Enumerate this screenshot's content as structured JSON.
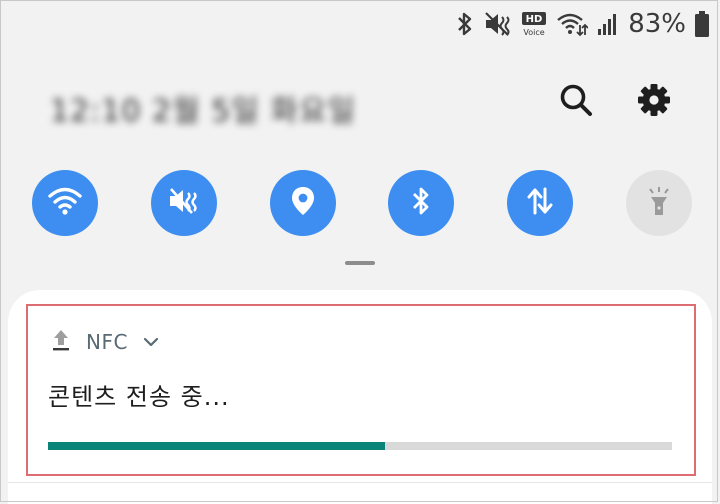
{
  "status_bar": {
    "icons": [
      "bluetooth-icon",
      "vibrate-icon",
      "hd-voice-icon",
      "wifi-calling-icon",
      "signal-icon",
      "battery-icon"
    ],
    "hd_label": "HD",
    "voice_label": "Voice",
    "battery_percent": "83%"
  },
  "header": {
    "datetime": "12:10 2월 5일 화요일",
    "search_icon": "search-icon",
    "settings_icon": "gear-icon"
  },
  "quick_settings": [
    {
      "name": "wifi",
      "icon": "wifi-icon",
      "active": true
    },
    {
      "name": "sound",
      "icon": "vibrate-icon",
      "active": true
    },
    {
      "name": "location",
      "icon": "location-pin-icon",
      "active": true
    },
    {
      "name": "bluetooth",
      "icon": "bluetooth-icon",
      "active": true
    },
    {
      "name": "mobile-data",
      "icon": "data-arrows-icon",
      "active": true
    },
    {
      "name": "flashlight",
      "icon": "flashlight-icon",
      "active": false
    }
  ],
  "notification": {
    "app_icon": "upload-icon",
    "app_name": "NFC",
    "expand_icon": "chevron-down-icon",
    "title": "콘텐츠 전송 중...",
    "progress": 0.54
  },
  "colors": {
    "tile_active": "#3d8ef0",
    "tile_inactive": "#e2e2e2",
    "progress_fill": "#0a8478",
    "progress_track": "#d9d9d9",
    "highlight_border": "#dd6d72"
  }
}
